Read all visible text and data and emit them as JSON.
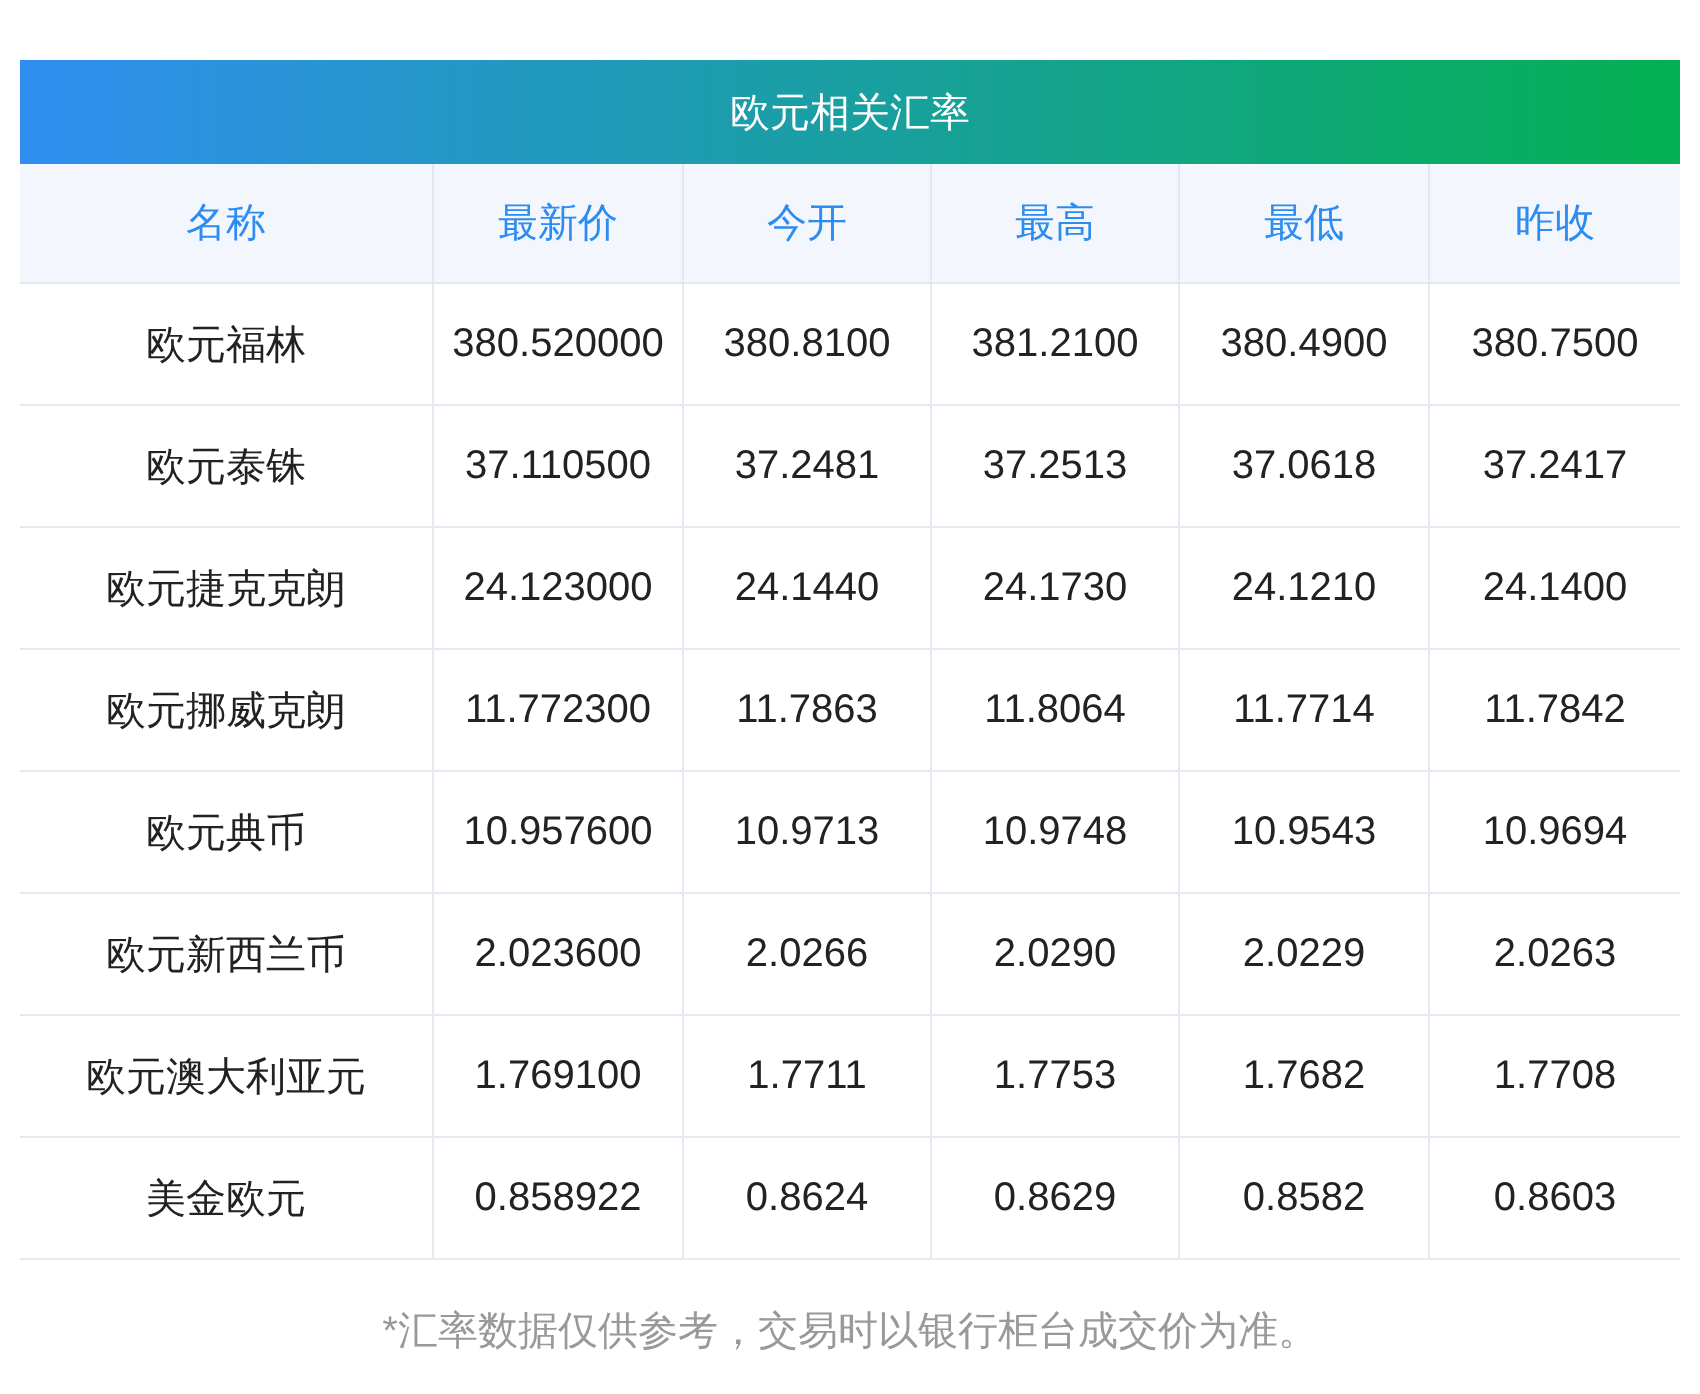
{
  "title": "欧元相关汇率",
  "columns": [
    "名称",
    "最新价",
    "今开",
    "最高",
    "最低",
    "昨收"
  ],
  "rows": [
    [
      "欧元福林",
      "380.520000",
      "380.8100",
      "381.2100",
      "380.4900",
      "380.7500"
    ],
    [
      "欧元泰铢",
      "37.110500",
      "37.2481",
      "37.2513",
      "37.0618",
      "37.2417"
    ],
    [
      "欧元捷克克朗",
      "24.123000",
      "24.1440",
      "24.1730",
      "24.1210",
      "24.1400"
    ],
    [
      "欧元挪威克朗",
      "11.772300",
      "11.7863",
      "11.8064",
      "11.7714",
      "11.7842"
    ],
    [
      "欧元典币",
      "10.957600",
      "10.9713",
      "10.9748",
      "10.9543",
      "10.9694"
    ],
    [
      "欧元新西兰币",
      "2.023600",
      "2.0266",
      "2.0290",
      "2.0229",
      "2.0263"
    ],
    [
      "欧元澳大利亚元",
      "1.769100",
      "1.7711",
      "1.7753",
      "1.7682",
      "1.7708"
    ],
    [
      "美金欧元",
      "0.858922",
      "0.8624",
      "0.8629",
      "0.8582",
      "0.8603"
    ]
  ],
  "footnote": "*汇率数据仅供参考，交易时以银行柜台成交价为准。"
}
